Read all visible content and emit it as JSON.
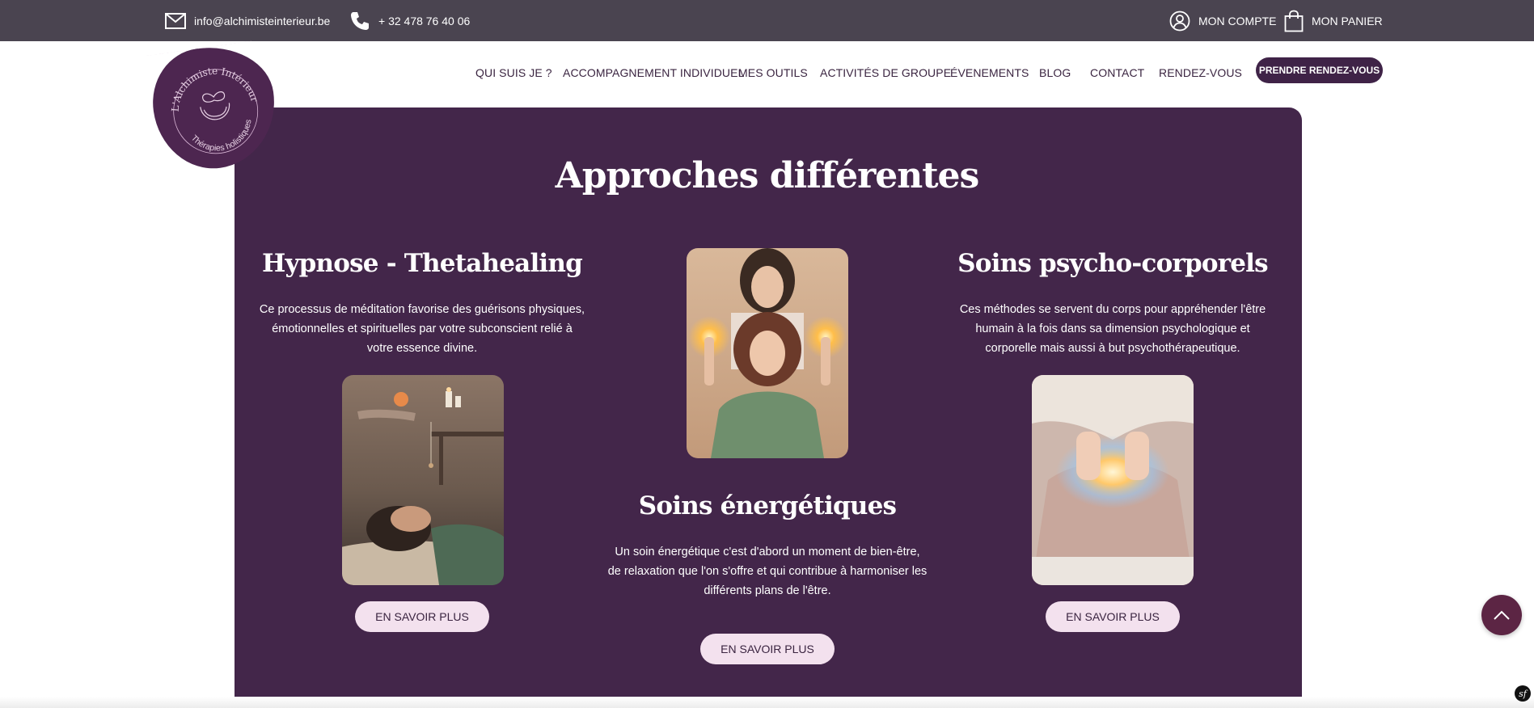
{
  "topbar": {
    "email": "info@alchimisteinterieur.be",
    "phone": "+ 32 478 76 40 06",
    "account": "MON COMPTE",
    "cart": "MON PANIER"
  },
  "logo": {
    "arc_text": "L'Alchimiste Intérieur",
    "bottom_text": "Thérapies holistiques"
  },
  "nav": {
    "items": [
      {
        "label": "QUI SUIS JE ?"
      },
      {
        "label": "ACCOMPAGNEMENT INDIVIDUEL"
      },
      {
        "label": "MES OUTILS"
      },
      {
        "label": "ACTIVITÉS DE GROUPE"
      },
      {
        "label": "ÉVENEMENTS"
      },
      {
        "label": "BLOG"
      },
      {
        "label": "CONTACT"
      },
      {
        "label": "RENDEZ-VOUS"
      }
    ],
    "cta": "PRENDRE RENDEZ-VOUS"
  },
  "section": {
    "title": "Approches différentes",
    "columns": [
      {
        "title": "Hypnose - Thetahealing",
        "lines": [
          "Ce processus de méditation favorise des guérisons physiques,",
          "émotionnelles et spirituelles par votre subconscient relié à",
          "votre essence divine."
        ],
        "button": "EN SAVOIR PLUS"
      },
      {
        "title": "Soins énergétiques",
        "lines": [
          "Un soin énergétique c'est d'abord un moment de bien-être,",
          "de relaxation que l'on s'offre et qui contribue à harmoniser les",
          "différents plans de l'être."
        ],
        "button": "EN SAVOIR PLUS"
      },
      {
        "title": "Soins psycho-corporels",
        "lines": [
          "Ces méthodes se servent du corps pour appréhender l'être",
          "humain à la fois dans sa dimension psychologique et",
          "corporelle mais aussi à but psychothérapeutique."
        ],
        "button": "EN SAVOIR PLUS"
      }
    ]
  },
  "colors": {
    "topbar": "#4a4450",
    "panel": "#43264a",
    "accent": "#3f2347",
    "button_bg": "#f3e1ee",
    "scroll_top": "#5c2544"
  },
  "icons": {
    "email": "envelope-icon",
    "phone": "phone-icon",
    "account": "user-circle-icon",
    "cart": "shopping-bag-icon",
    "scroll_top": "chevron-up-icon",
    "badge": "symfony-icon"
  },
  "badge": "sf"
}
